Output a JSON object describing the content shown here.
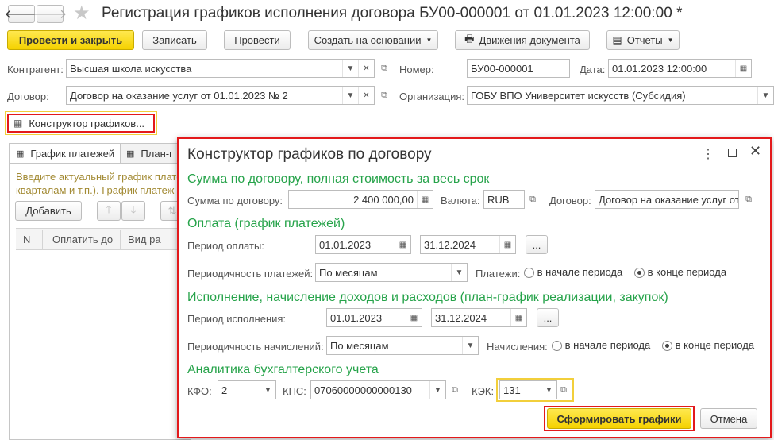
{
  "window": {
    "title": "Регистрация графиков исполнения договора БУ00-000001 от 01.01.2023 12:00:00 *"
  },
  "toolbar": {
    "post_close": "Провести и закрыть",
    "write": "Записать",
    "post": "Провести",
    "create_based": "Создать на основании",
    "movements": "Движения документа",
    "reports": "Отчеты"
  },
  "header": {
    "contractor_label": "Контрагент:",
    "contractor_value": "Высшая школа искусства",
    "number_label": "Номер:",
    "number_value": "БУ00-000001",
    "date_label": "Дата:",
    "date_value": "01.01.2023 12:00:00",
    "contract_label": "Договор:",
    "contract_value": "Договор на оказание услуг от 01.01.2023 № 2",
    "org_label": "Организация:",
    "org_value": "ГОБУ ВПО Университет искусств (Субсидия)"
  },
  "constructor_button": "Конструктор графиков...",
  "tabs": [
    {
      "label": "График платежей"
    },
    {
      "label": "План-г"
    }
  ],
  "tab_content": {
    "hint_line1": "Введите актуальный график плате",
    "hint_line2": "кварталам и т.п.). График платеж",
    "add_button": "Добавить",
    "columns": [
      "N",
      "Оплатить до",
      "Вид ра"
    ]
  },
  "dialog": {
    "title": "Конструктор графиков по договору",
    "section_sum": "Сумма по договору, полная стоимость за весь срок",
    "sum_label": "Сумма по договору:",
    "sum_value": "2 400 000,00",
    "currency_label": "Валюта:",
    "currency_value": "RUB",
    "contract_label": "Договор:",
    "contract_value": "Договор на оказание услуг от",
    "section_payment": "Оплата (график платежей)",
    "pay_period_label": "Период оплаты:",
    "pay_from": "01.01.2023",
    "pay_to": "31.12.2024",
    "ellipsis": "...",
    "pay_freq_label": "Периодичность платежей:",
    "pay_freq_value": "По месяцам",
    "payments_label": "Платежи:",
    "radio_start": "в начале периода",
    "radio_end": "в конце периода",
    "section_exec": "Исполнение, начисление доходов и расходов (план-график реализации, закупок)",
    "exec_period_label": "Период исполнения:",
    "exec_from": "01.01.2023",
    "exec_to": "31.12.2024",
    "accr_freq_label": "Периодичность начислений:",
    "accr_freq_value": "По месяцам",
    "accruals_label": "Начисления:",
    "section_analytics": "Аналитика бухгалтерского учета",
    "kfo_label": "КФО:",
    "kfo_value": "2",
    "kps_label": "КПС:",
    "kps_value": "07060000000000130",
    "kek_label": "КЭК:",
    "kek_value": "131",
    "generate_button": "Сформировать графики",
    "cancel_button": "Отмена"
  }
}
